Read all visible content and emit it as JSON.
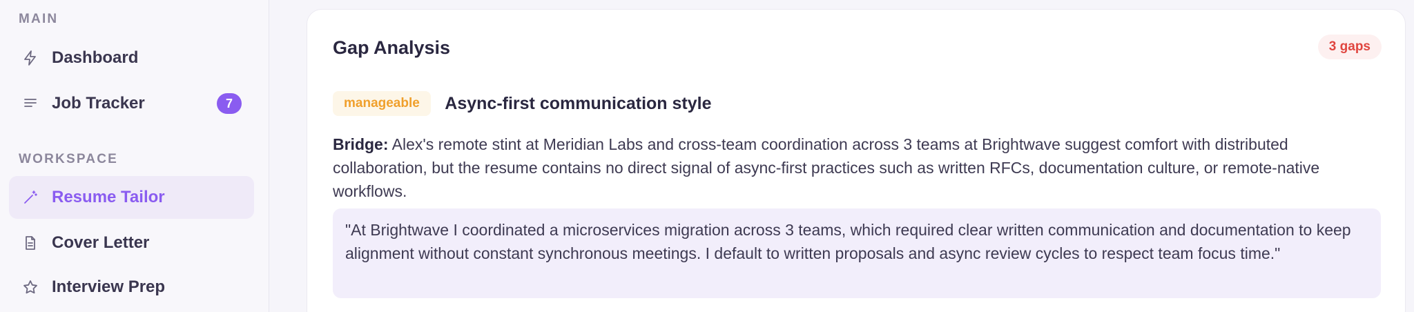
{
  "sidebar": {
    "sections": [
      {
        "label": "MAIN"
      },
      {
        "label": "WORKSPACE"
      }
    ],
    "items": [
      {
        "label": "Dashboard",
        "icon": "lightning-icon"
      },
      {
        "label": "Job Tracker",
        "icon": "list-icon",
        "badge": "7"
      },
      {
        "label": "Resume Tailor",
        "icon": "magic-wand-icon",
        "active": true
      },
      {
        "label": "Cover Letter",
        "icon": "document-icon"
      },
      {
        "label": "Interview Prep",
        "icon": "star-icon"
      }
    ]
  },
  "main": {
    "card": {
      "title": "Gap Analysis",
      "count_badge": "3 gaps",
      "gaps": [
        {
          "severity": "manageable",
          "title": "Async-first communication style",
          "bridge_label": "Bridge:",
          "bridge_text": " Alex's remote stint at Meridian Labs and cross-team coordination across 3 teams at Brightwave suggest comfort with distributed collaboration, but the resume contains no direct signal of async-first practices such as written RFCs, documentation culture, or remote-native workflows.",
          "quote": "\"At Brightwave I coordinated a microservices migration across 3 teams, which required clear written communication and documentation to keep alignment without constant synchronous meetings. I default to written proposals and async review cycles to respect team focus time.\""
        }
      ]
    }
  },
  "colors": {
    "accent": "#8a5cf0",
    "danger": "#e0453f",
    "warning": "#f0a02c"
  }
}
